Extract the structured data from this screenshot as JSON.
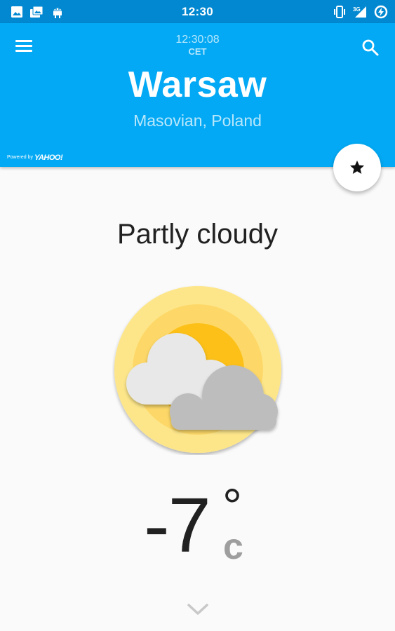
{
  "status_bar": {
    "time": "12:30",
    "left_icons": [
      "image-icon",
      "photo-album-icon",
      "android-debug-icon"
    ],
    "right_icons": [
      "vibrate-icon",
      "signal-3g-icon",
      "battery-charging-icon"
    ],
    "network_label": "3G"
  },
  "app_bar": {
    "clock_time": "12:30:08",
    "timezone": "CET",
    "city": "Warsaw",
    "region": "Masovian, Poland",
    "powered_by": "Powered by",
    "provider": "YAHOO!",
    "menu_icon": "hamburger-menu-icon",
    "search_icon": "search-icon",
    "color": "#03a9f4"
  },
  "favorite_button": {
    "icon": "star-icon"
  },
  "weather": {
    "condition": "Partly cloudy",
    "icon": "partly-cloudy-icon",
    "temperature": "-7",
    "degree_symbol": "°",
    "unit": "c"
  },
  "expand_icon": "chevron-down-icon"
}
